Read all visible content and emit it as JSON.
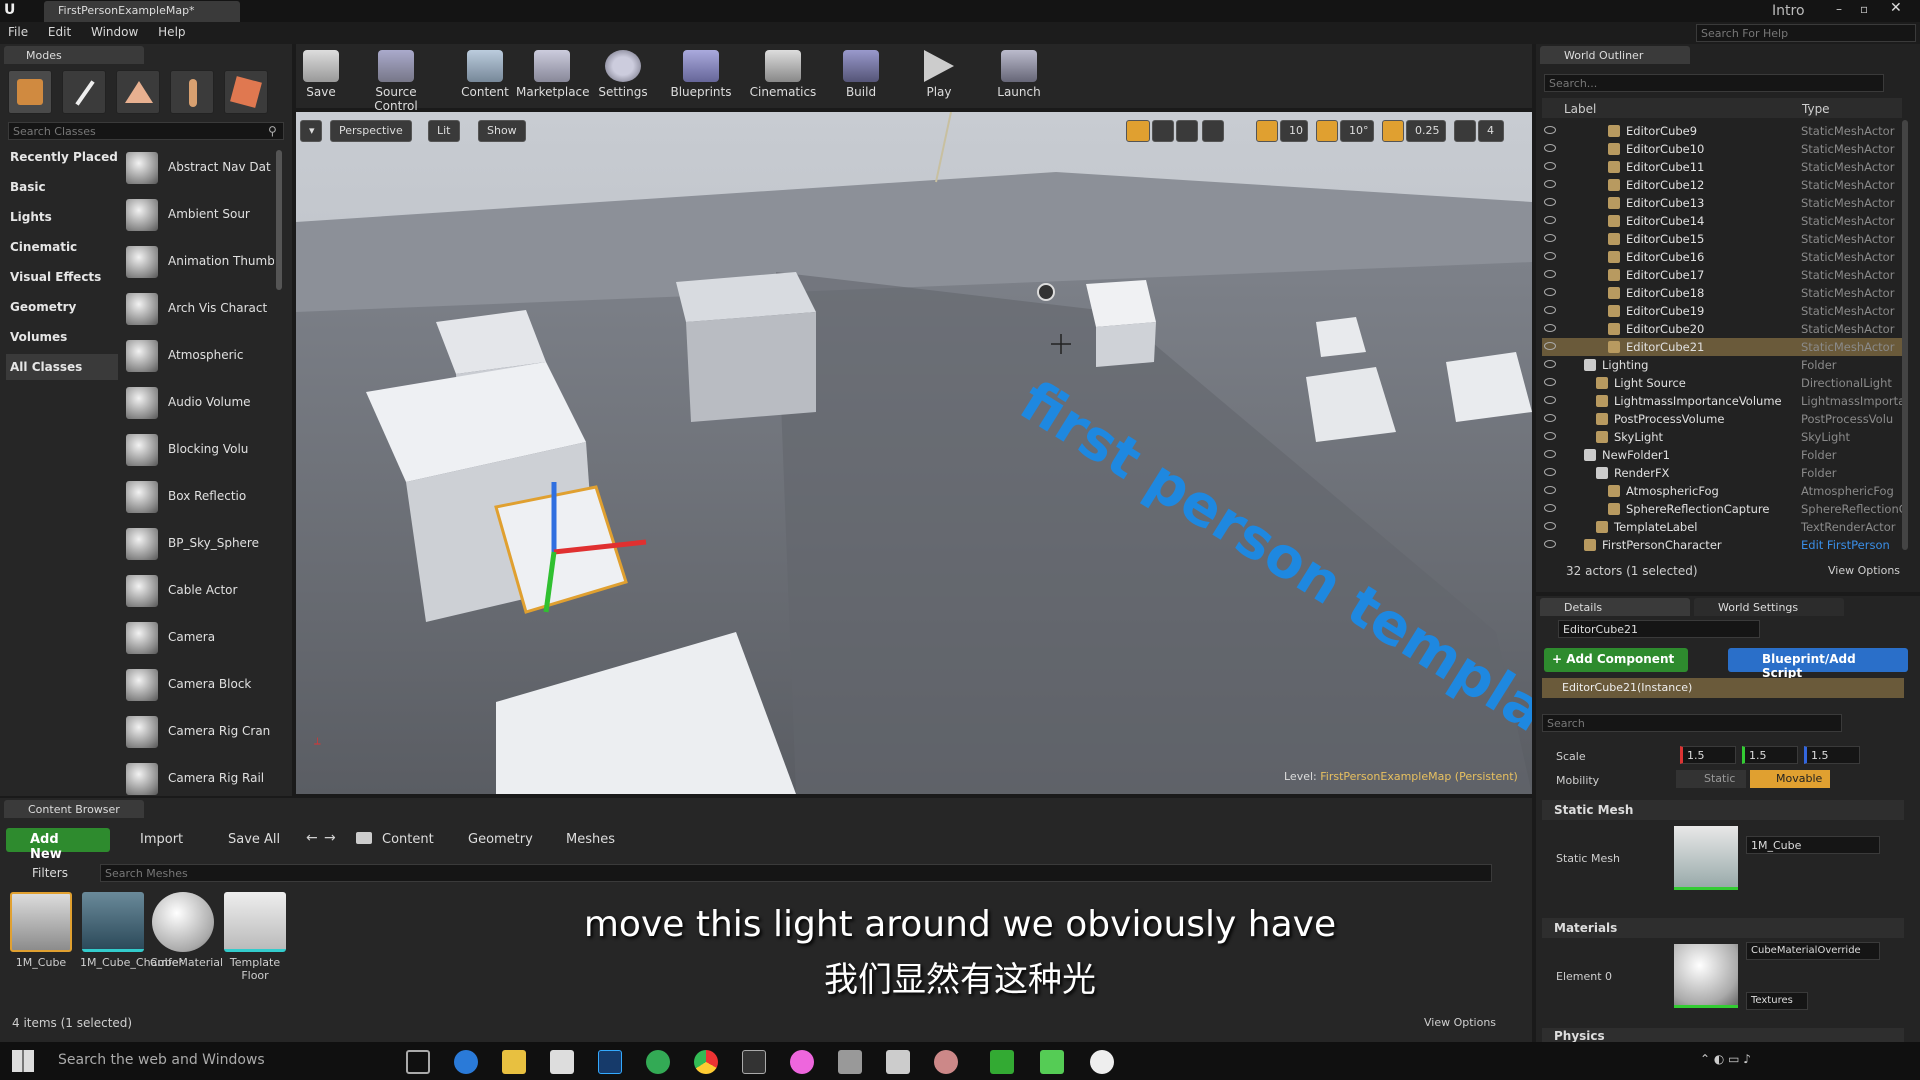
{
  "window": {
    "tab_title": "FirstPersonExampleMap*",
    "user": "Intro",
    "help_search_placeholder": "Search For Help"
  },
  "menu": [
    "File",
    "Edit",
    "Window",
    "Help"
  ],
  "modes": {
    "tab": "Modes",
    "search_placeholder": "Search Classes",
    "categories": [
      "Recently Placed",
      "Basic",
      "Lights",
      "Cinematic",
      "Visual Effects",
      "Geometry",
      "Volumes",
      "All Classes"
    ],
    "classes": [
      "Abstract Nav Dat",
      "Ambient Sour",
      "Animation Thumb",
      "Arch Vis Charact",
      "Atmospheric",
      "Audio Volume",
      "Blocking Volu",
      "Box Reflectio",
      "BP_Sky_Sphere",
      "Cable Actor",
      "Camera",
      "Camera Block",
      "Camera Rig Cran",
      "Camera Rig Rail"
    ]
  },
  "toolbar": [
    "Save",
    "Source Control",
    "Content",
    "Marketplace",
    "Settings",
    "Blueprints",
    "Cinematics",
    "Build",
    "Play",
    "Launch"
  ],
  "viewport": {
    "perspective": "Perspective",
    "lit": "Lit",
    "show": "Show",
    "grid": "10",
    "angle": "10°",
    "scale": "0.25",
    "cam_speed": "4",
    "level_label": "Level:",
    "level_name": "FirstPersonExampleMap (Persistent)",
    "floor_text": "first person template"
  },
  "outliner": {
    "tab": "World Outliner",
    "search_placeholder": "Search...",
    "col_label": "Label",
    "col_type": "Type",
    "rows": [
      {
        "label": "EditorCube9",
        "type": "StaticMeshActor",
        "indent": 4
      },
      {
        "label": "EditorCube10",
        "type": "StaticMeshActor",
        "indent": 4
      },
      {
        "label": "EditorCube11",
        "type": "StaticMeshActor",
        "indent": 4
      },
      {
        "label": "EditorCube12",
        "type": "StaticMeshActor",
        "indent": 4
      },
      {
        "label": "EditorCube13",
        "type": "StaticMeshActor",
        "indent": 4
      },
      {
        "label": "EditorCube14",
        "type": "StaticMeshActor",
        "indent": 4
      },
      {
        "label": "EditorCube15",
        "type": "StaticMeshActor",
        "indent": 4
      },
      {
        "label": "EditorCube16",
        "type": "StaticMeshActor",
        "indent": 4
      },
      {
        "label": "EditorCube17",
        "type": "StaticMeshActor",
        "indent": 4
      },
      {
        "label": "EditorCube18",
        "type": "StaticMeshActor",
        "indent": 4
      },
      {
        "label": "EditorCube19",
        "type": "StaticMeshActor",
        "indent": 4
      },
      {
        "label": "EditorCube20",
        "type": "StaticMeshActor",
        "indent": 4
      },
      {
        "label": "EditorCube21",
        "type": "StaticMeshActor",
        "indent": 4,
        "selected": true
      },
      {
        "label": "Lighting",
        "type": "Folder",
        "indent": 2,
        "folder": true
      },
      {
        "label": "Light Source",
        "type": "DirectionalLight",
        "indent": 3
      },
      {
        "label": "LightmassImportanceVolume",
        "type": "LightmassImporta",
        "indent": 3
      },
      {
        "label": "PostProcessVolume",
        "type": "PostProcessVolu",
        "indent": 3
      },
      {
        "label": "SkyLight",
        "type": "SkyLight",
        "indent": 3
      },
      {
        "label": "NewFolder1",
        "type": "Folder",
        "indent": 2,
        "folder": true
      },
      {
        "label": "RenderFX",
        "type": "Folder",
        "indent": 3,
        "folder": true
      },
      {
        "label": "AtmosphericFog",
        "type": "AtmosphericFog",
        "indent": 4
      },
      {
        "label": "SphereReflectionCapture",
        "type": "SphereReflectionC",
        "indent": 4
      },
      {
        "label": "TemplateLabel",
        "type": "TextRenderActor",
        "indent": 3
      },
      {
        "label": "FirstPersonCharacter",
        "type": "Edit FirstPerson",
        "indent": 2,
        "link": true
      }
    ],
    "footer": "32 actors (1 selected)",
    "view_options": "View Options"
  },
  "details": {
    "tab1": "Details",
    "tab2": "World Settings",
    "name": "EditorCube21",
    "add_component": "+ Add Component",
    "blueprint": "Blueprint/Add Script",
    "instance": "EditorCube21(Instance)",
    "search_placeholder": "Search",
    "scale_label": "Scale",
    "scale_x": "1.5",
    "scale_y": "1.5",
    "scale_z": "1.5",
    "mobility_label": "Mobility",
    "static": "Static",
    "movable": "Movable",
    "static_mesh_section": "Static Mesh",
    "static_mesh_label": "Static Mesh",
    "mesh_value": "1M_Cube",
    "materials_section": "Materials",
    "element0": "Element 0",
    "material_value": "CubeMaterialOverride",
    "textures": "Textures",
    "physics_section": "Physics"
  },
  "content_browser": {
    "tab": "Content Browser",
    "add_new": "Add New",
    "import": "Import",
    "save_all": "Save All",
    "path": [
      "Content",
      "Geometry",
      "Meshes"
    ],
    "filters": "Filters",
    "search_placeholder": "Search Meshes",
    "assets": [
      "1M_Cube",
      "1M_Cube_Chamfer",
      "CubeMaterial",
      "Template Floor"
    ],
    "footer": "4 items (1 selected)",
    "view_options": "View Options"
  },
  "subtitles": {
    "en": "move this light around we obviously have",
    "zh": "我们显然有这种光"
  },
  "taskbar": {
    "search": "Search the web and Windows"
  },
  "colors": {
    "accent_orange": "#e0a030",
    "green": "#2e8b2e",
    "blue": "#2a6fc9",
    "selection": "#6a5a3a"
  }
}
